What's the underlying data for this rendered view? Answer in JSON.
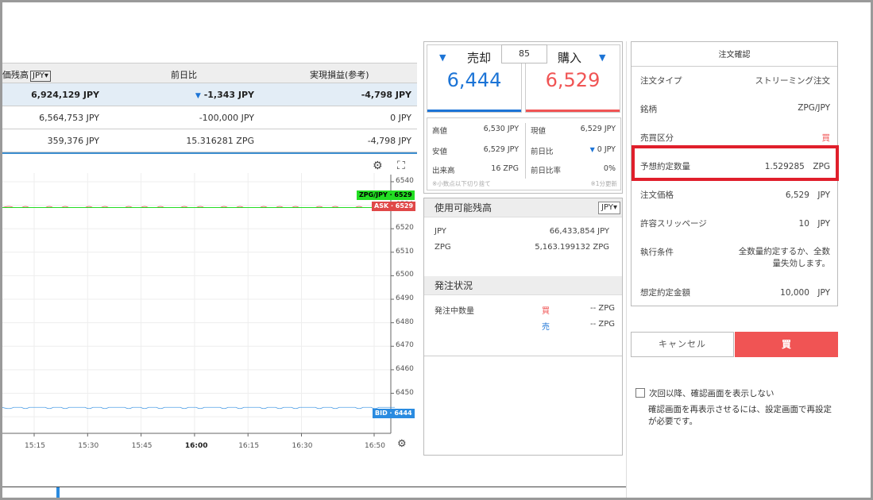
{
  "balance_table": {
    "headers": {
      "c1": "価残高",
      "sel": "JPY▾",
      "c2": "前日比",
      "c3": "実現損益(参考)"
    },
    "rows": [
      {
        "c1": "6,924,129 JPY",
        "c2": "-1,343 JPY",
        "c3": "-4,798 JPY"
      },
      {
        "c1": "6,564,753 JPY",
        "c2": "-100,000 JPY",
        "c3": "0 JPY"
      },
      {
        "c1": "359,376 JPY",
        "c2": "15.316281 ZPG",
        "c3": "-4,798 JPY"
      }
    ]
  },
  "chart_data": {
    "type": "line",
    "x": [
      "15:15",
      "15:30",
      "15:45",
      "16:00",
      "16:15",
      "16:30",
      "16:50"
    ],
    "y_ticks": [
      6540,
      6530,
      6520,
      6510,
      6500,
      6490,
      6480,
      6470,
      6460,
      6450,
      6440
    ],
    "ylim": [
      6437,
      6541
    ],
    "series": [
      {
        "name": "ASK",
        "value": 6529,
        "color": "#e04848"
      },
      {
        "name": "BID",
        "value": 6444,
        "color": "#2a8be0"
      },
      {
        "name": "ZPG/JPY",
        "value": 6529,
        "color": "#22dd22"
      }
    ],
    "tags": {
      "pair": "ZPG/JPY · 6529",
      "ask": "ASK · 6529",
      "bid": "BID · 6444"
    },
    "gear": "⚙",
    "expand": "⛶"
  },
  "trade": {
    "sell_label": "売却",
    "buy_label": "購入",
    "quantity": "85",
    "sell_price": "6,444",
    "buy_price": "6,529",
    "sell_color": "#1c74d6",
    "buy_color": "#f05454",
    "stats": {
      "high_label": "高値",
      "high_value": "6,530 JPY",
      "low_label": "安値",
      "low_value": "6,529 JPY",
      "volume_label": "出来高",
      "volume_value": "16 ZPG",
      "current_label": "現値",
      "current_value": "6,529 JPY",
      "change_label": "前日比",
      "change_value": "0 JPY",
      "rate_label": "前日比率",
      "rate_value": "0%",
      "note_left": "※小数点以下切り捨て",
      "note_right": "※1分更新"
    }
  },
  "available": {
    "title": "使用可能残高",
    "currency": "JPY▾",
    "jpy_label": "JPY",
    "jpy_value": "66,433,854 JPY",
    "zpg_label": "ZPG",
    "zpg_value": "5,163.199132 ZPG",
    "orders_title": "発注状況",
    "pending_label": "発注中数量",
    "buy": "買",
    "buy_value": "-- ZPG",
    "sell": "売",
    "sell_value": "-- ZPG"
  },
  "confirm": {
    "title": "注文確認",
    "items": [
      {
        "label": "注文タイプ",
        "value": "ストリーミング注文"
      },
      {
        "label": "銘柄",
        "value": "ZPG/JPY"
      },
      {
        "label": "売買区分",
        "value": "買"
      },
      {
        "label": "予想約定数量",
        "value": "1.529285　ZPG"
      },
      {
        "label": "注文価格",
        "value": "6,529　JPY"
      },
      {
        "label": "許容スリッページ",
        "value": "10　JPY"
      },
      {
        "label": "執行条件",
        "value": "全数量約定するか、全数量失効します。"
      },
      {
        "label": "想定約定金額",
        "value": "10,000　JPY"
      }
    ],
    "cancel": "キャンセル",
    "buy": "買",
    "checkbox_label": "次回以降、確認画面を表示しない",
    "note": "確認画面を再表示させるには、設定画面で再設定が必要です。"
  }
}
